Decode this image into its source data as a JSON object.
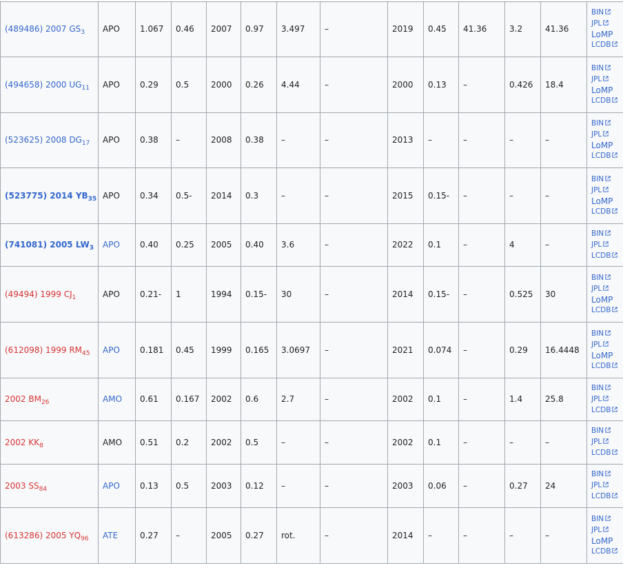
{
  "rows": [
    {
      "num": "(489486)",
      "desig": "2007 GS",
      "sub": "3",
      "name_style": "blue",
      "class": "APO",
      "class_link": false,
      "c1": "1.067",
      "c2": "0.46",
      "c3": "2007",
      "c4": "0.97",
      "c5": "3.497",
      "c6": "–",
      "c7": "2019",
      "c8": "0.45",
      "c9": "41.36",
      "c10": "3.2",
      "c11": "41.36",
      "links": [
        "BIN",
        "JPL",
        "LoMP",
        "LCDB"
      ]
    },
    {
      "num": "(494658)",
      "desig": "2000 UG",
      "sub": "11",
      "name_style": "blue",
      "class": "APO",
      "class_link": false,
      "c1": "0.29",
      "c2": "0.5",
      "c3": "2000",
      "c4": "0.26",
      "c5": "4.44",
      "c6": "–",
      "c7": "2000",
      "c8": "0.13",
      "c9": "–",
      "c10": "0.426",
      "c11": "18.4",
      "links": [
        "BIN",
        "JPL",
        "LoMP",
        "LCDB"
      ]
    },
    {
      "num": "(523625)",
      "desig": "2008 DG",
      "sub": "17",
      "name_style": "blue",
      "class": "APO",
      "class_link": false,
      "c1": "0.38",
      "c2": "–",
      "c3": "2008",
      "c4": "0.38",
      "c5": "–",
      "c6": "–",
      "c7": "2013",
      "c8": "–",
      "c9": "–",
      "c10": "–",
      "c11": "–",
      "links": [
        "BIN",
        "JPL",
        "LoMP",
        "LCDB"
      ]
    },
    {
      "num": "(523775)",
      "desig": "2014 YB",
      "sub": "35",
      "name_style": "bold",
      "class": "APO",
      "class_link": false,
      "c1": "0.34",
      "c2": "0.5-",
      "c3": "2014",
      "c4": "0.3",
      "c5": "–",
      "c6": "–",
      "c7": "2015",
      "c8": "0.15-",
      "c9": "–",
      "c10": "–",
      "c11": "–",
      "links": [
        "BIN",
        "JPL",
        "LoMP",
        "LCDB"
      ]
    },
    {
      "num": "(741081)",
      "desig": "2005 LW",
      "sub": "3",
      "name_style": "bold",
      "class": "APO",
      "class_link": true,
      "c1": "0.40",
      "c2": "0.25",
      "c3": "2005",
      "c4": "0.40",
      "c5": "3.6",
      "c6": "–",
      "c7": "2022",
      "c8": "0.1",
      "c9": "–",
      "c10": "4",
      "c11": "–",
      "links": [
        "BIN",
        "JPL",
        "LCDB"
      ]
    },
    {
      "num": "(49494)",
      "desig": "1999 CJ",
      "sub": "1",
      "name_style": "red",
      "class": "APO",
      "class_link": false,
      "c1": "0.21-",
      "c2": "1",
      "c3": "1994",
      "c4": "0.15-",
      "c5": "30",
      "c6": "–",
      "c7": "2014",
      "c8": "0.15-",
      "c9": "–",
      "c10": "0.525",
      "c11": "30",
      "links": [
        "BIN",
        "JPL",
        "LoMP",
        "LCDB"
      ]
    },
    {
      "num": "(612098)",
      "desig": "1999 RM",
      "sub": "45",
      "name_style": "red",
      "class": "APO",
      "class_link": true,
      "c1": "0.181",
      "c2": "0.45",
      "c3": "1999",
      "c4": "0.165",
      "c5": "3.0697",
      "c6": "–",
      "c7": "2021",
      "c8": "0.074",
      "c9": "–",
      "c10": "0.29",
      "c11": "16.4448",
      "links": [
        "BIN",
        "JPL",
        "LoMP",
        "LCDB"
      ]
    },
    {
      "num": "",
      "desig": "2002 BM",
      "sub": "26",
      "name_style": "red",
      "class": "AMO",
      "class_link": true,
      "c1": "0.61",
      "c2": "0.167",
      "c3": "2002",
      "c4": "0.6",
      "c5": "2.7",
      "c6": "–",
      "c7": "2002",
      "c8": "0.1",
      "c9": "–",
      "c10": "1.4",
      "c11": "25.8",
      "links": [
        "BIN",
        "JPL",
        "LCDB"
      ]
    },
    {
      "num": "",
      "desig": "2002 KK",
      "sub": "8",
      "name_style": "red",
      "class": "AMO",
      "class_link": false,
      "c1": "0.51",
      "c2": "0.2",
      "c3": "2002",
      "c4": "0.5",
      "c5": "–",
      "c6": "–",
      "c7": "2002",
      "c8": "0.1",
      "c9": "–",
      "c10": "–",
      "c11": "–",
      "links": [
        "BIN",
        "JPL",
        "LCDB"
      ]
    },
    {
      "num": "",
      "desig": "2003 SS",
      "sub": "84",
      "name_style": "red",
      "class": "APO",
      "class_link": true,
      "c1": "0.13",
      "c2": "0.5",
      "c3": "2003",
      "c4": "0.12",
      "c5": "–",
      "c6": "–",
      "c7": "2003",
      "c8": "0.06",
      "c9": "–",
      "c10": "0.27",
      "c11": "24",
      "links": [
        "BIN",
        "JPL",
        "LCDB"
      ]
    },
    {
      "num": "(613286)",
      "desig": "2005 YQ",
      "sub": "96",
      "name_style": "red",
      "class": "ATE",
      "class_link": true,
      "c1": "0.27",
      "c2": "–",
      "c3": "2005",
      "c4": "0.27",
      "c5": "rot.",
      "c6": "–",
      "c7": "2014",
      "c8": "–",
      "c9": "–",
      "c10": "–",
      "c11": "–",
      "links": [
        "BIN",
        "JPL",
        "LoMP",
        "LCDB"
      ]
    }
  ],
  "ext_icon": "external-link-icon"
}
